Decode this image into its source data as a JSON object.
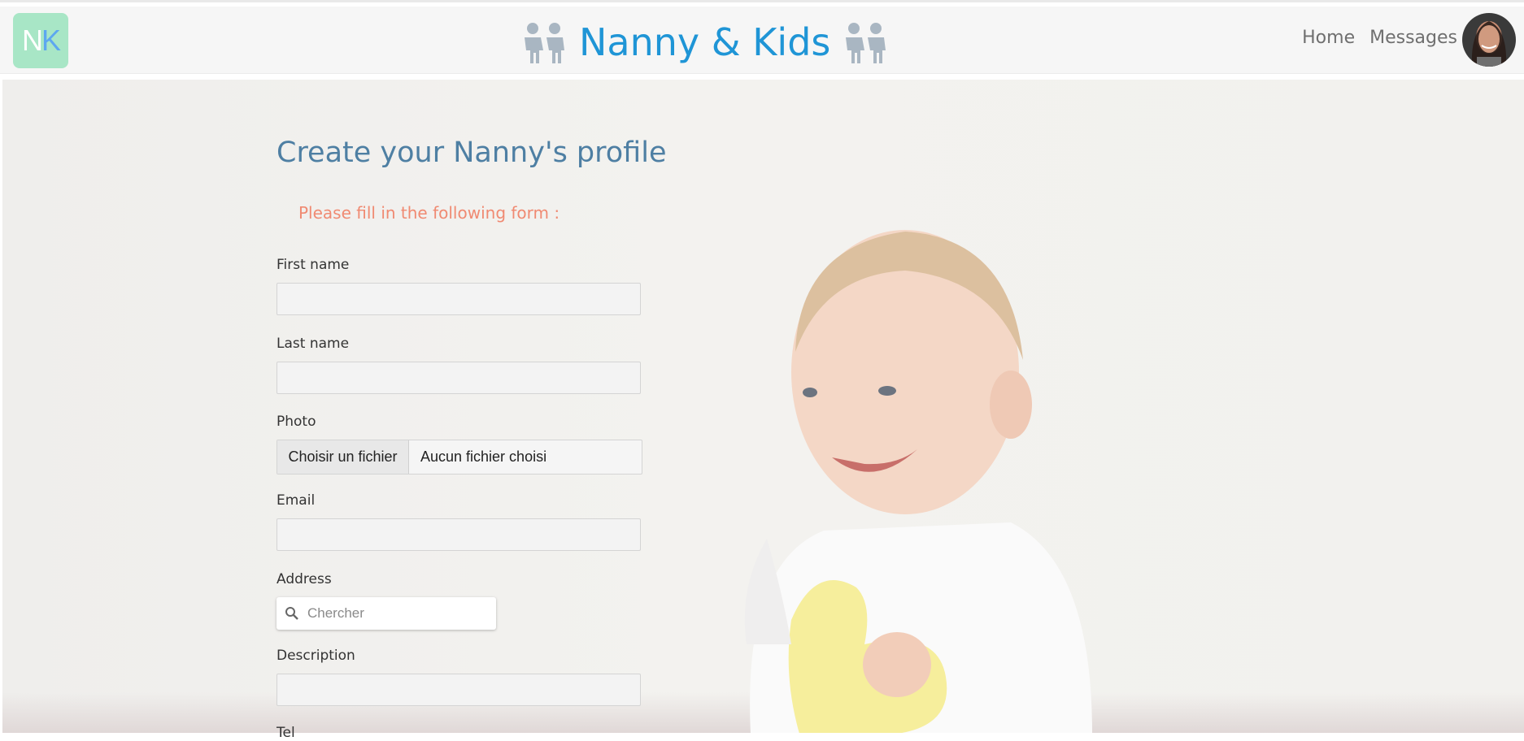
{
  "header": {
    "logo_text_n": "N",
    "logo_text_k": "K",
    "brand_title": "Nanny & Kids",
    "nav": {
      "home": "Home",
      "messages": "Messages"
    }
  },
  "form": {
    "title": "Create your Nanny's profile",
    "subtitle": "Please fill in the following form :",
    "fields": {
      "first_name": "First name",
      "last_name": "Last name",
      "photo": "Photo",
      "email": "Email",
      "address": "Address",
      "description": "Description",
      "tel": "Tel"
    },
    "file": {
      "button_label": "Choisir un fichier",
      "status": "Aucun fichier choisi"
    },
    "address_search": {
      "placeholder": "Chercher"
    }
  },
  "colors": {
    "brand": "#1f95d6",
    "title": "#4e7fa3",
    "subtitle": "#f08a72",
    "logo_bg": "#a8e6c6"
  },
  "icons": [
    "kids-icon",
    "search-icon",
    "avatar"
  ]
}
